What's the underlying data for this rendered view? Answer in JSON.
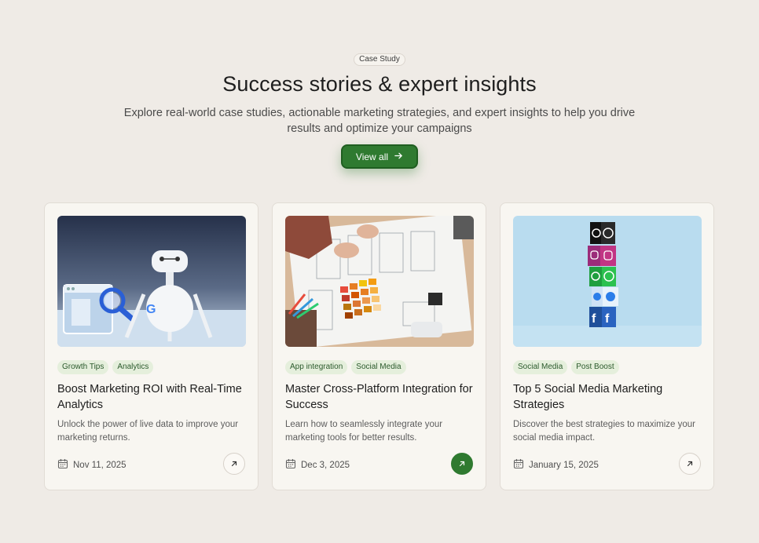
{
  "header": {
    "badge": "Case Study",
    "title": "Success stories & expert insights",
    "subtitle": "Explore real-world case studies, actionable marketing strategies, and expert insights to help you drive results and optimize your campaigns",
    "cta_label": "View all",
    "cta_icon": "arrow-right-icon"
  },
  "colors": {
    "background": "#efebe6",
    "accent": "#2f7a30",
    "tag_bg": "#e5efdc",
    "tag_text": "#2b5a2c"
  },
  "cards": [
    {
      "tags": [
        "Growth Tips",
        "Analytics"
      ],
      "title": "Boost Marketing ROI with Real-Time Analytics",
      "description": "Unlock the power of live data to improve your marketing returns.",
      "date": "Nov 11, 2025",
      "image": "robot-analytics-illustration",
      "active": false
    },
    {
      "tags": [
        "App integration",
        "Social Media"
      ],
      "title": "Master Cross-Platform Integration for Success",
      "description": "Learn how to seamlessly integrate your marketing tools for better results.",
      "date": "Dec 3, 2025",
      "image": "design-sketches-desk-photo",
      "active": true
    },
    {
      "tags": [
        "Social Media",
        "Post Boost"
      ],
      "title": "Top 5 Social Media Marketing Strategies",
      "description": "Discover the best strategies to maximize your social media impact.",
      "date": "January 15, 2025",
      "image": "social-media-cubes-stack",
      "active": false
    }
  ]
}
